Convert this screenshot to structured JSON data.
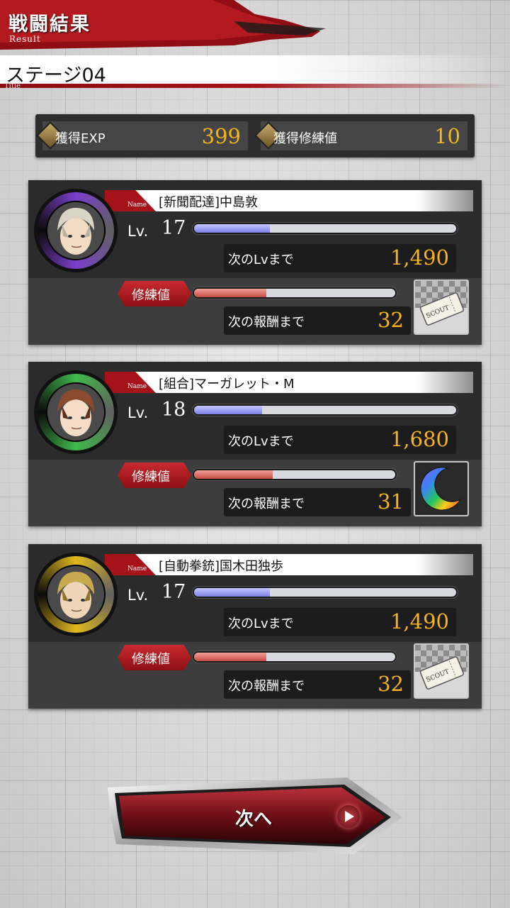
{
  "header": {
    "title": "戦闘結果",
    "subtitle": "Result"
  },
  "stage": {
    "name": "ステージ04",
    "subtitle": "Title"
  },
  "summary": {
    "exp_label": "獲得EXP",
    "exp_value": "399",
    "training_label": "獲得修練値",
    "training_value": "10"
  },
  "characters": [
    {
      "name_tag": "Name",
      "name": "[新聞配達]中島敦",
      "lv_label": "Lv.",
      "level": "17",
      "exp_progress": 0.29,
      "next_lv_label": "次のLvまで",
      "next_lv_value": "1,490",
      "training_label": "修練値",
      "training_progress": 0.36,
      "next_reward_label": "次の報酬まで",
      "next_reward_value": "32",
      "ring_color": "#7b3fc9",
      "reward_icon": "scout-ticket-icon"
    },
    {
      "name_tag": "Name",
      "name": "[組合]マーガレット・M",
      "lv_label": "Lv.",
      "level": "18",
      "exp_progress": 0.26,
      "next_lv_label": "次のLvまで",
      "next_lv_value": "1,680",
      "training_label": "修練値",
      "training_progress": 0.39,
      "next_reward_label": "次の報酬まで",
      "next_reward_value": "31",
      "ring_color": "#3fb84a",
      "reward_icon": "rainbow-crescent-icon"
    },
    {
      "name_tag": "Name",
      "name": "[自動拳銃]国木田独歩",
      "lv_label": "Lv.",
      "level": "17",
      "exp_progress": 0.29,
      "next_lv_label": "次のLvまで",
      "next_lv_value": "1,490",
      "training_label": "修練値",
      "training_progress": 0.36,
      "next_reward_label": "次の報酬まで",
      "next_reward_value": "32",
      "ring_color": "#e0b81c",
      "reward_icon": "scout-ticket-icon"
    }
  ],
  "ticket_text": "SCOUT",
  "next_button": {
    "label": "次へ"
  }
}
